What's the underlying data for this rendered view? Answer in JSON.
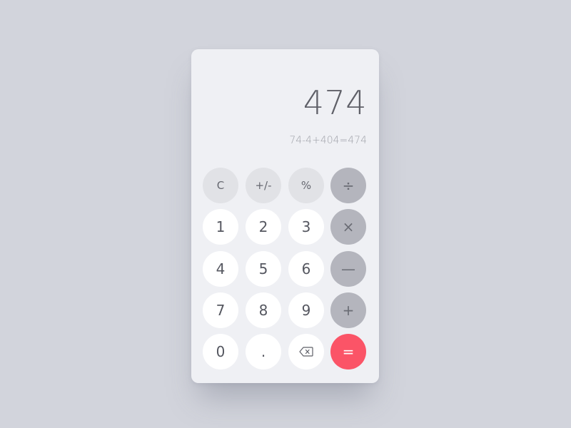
{
  "display": {
    "result": "474",
    "expression": "74-4+404=474"
  },
  "keys": {
    "clear": "C",
    "sign": "+/-",
    "percent": "%",
    "divide": "÷",
    "multiply": "×",
    "subtract": "—",
    "add": "+",
    "equals": "=",
    "decimal": ".",
    "d0": "0",
    "d1": "1",
    "d2": "2",
    "d3": "3",
    "d4": "4",
    "d5": "5",
    "d6": "6",
    "d7": "7",
    "d8": "8",
    "d9": "9",
    "backspace_icon": "backspace-icon"
  },
  "colors": {
    "background": "#d2d4dc",
    "panel": "#eff0f4",
    "digit_key": "#ffffff",
    "function_key": "#e1e2e6",
    "operator_key": "#b4b5bd",
    "equals_key": "#fb5467"
  }
}
